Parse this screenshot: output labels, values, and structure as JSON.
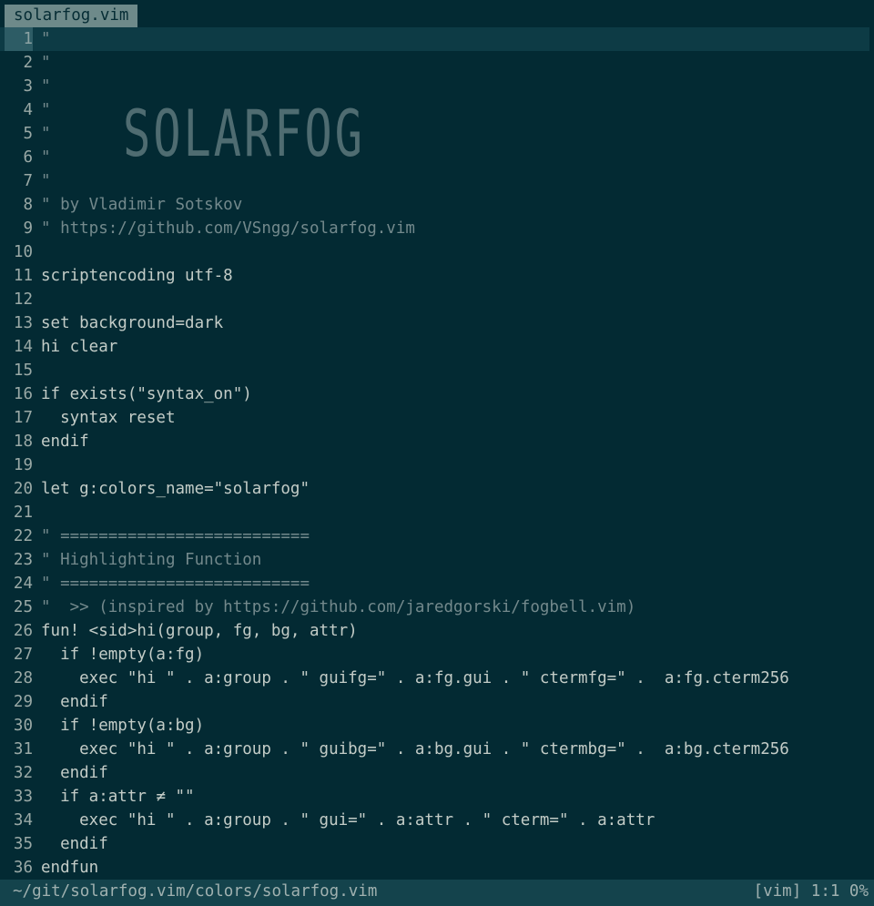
{
  "tabline": {
    "tab_label": "solarfog.vim"
  },
  "editor": {
    "logo_text": "SOLARFOG",
    "lines": [
      {
        "n": "1",
        "text": "\"",
        "comment": true
      },
      {
        "n": "2",
        "text": "\"",
        "comment": true
      },
      {
        "n": "3",
        "text": "\"",
        "comment": true
      },
      {
        "n": "4",
        "text": "\"",
        "comment": true
      },
      {
        "n": "5",
        "text": "\"",
        "comment": true
      },
      {
        "n": "6",
        "text": "\"",
        "comment": true
      },
      {
        "n": "7",
        "text": "\"",
        "comment": true
      },
      {
        "n": "8",
        "text": "\" by Vladimir Sotskov",
        "comment": true
      },
      {
        "n": "9",
        "text": "\" https://github.com/VSngg/solarfog.vim",
        "comment": true
      },
      {
        "n": "10",
        "text": "",
        "comment": false
      },
      {
        "n": "11",
        "text": "scriptencoding utf-8",
        "comment": false
      },
      {
        "n": "12",
        "text": "",
        "comment": false
      },
      {
        "n": "13",
        "text": "set background=dark",
        "comment": false
      },
      {
        "n": "14",
        "text": "hi clear",
        "comment": false
      },
      {
        "n": "15",
        "text": "",
        "comment": false
      },
      {
        "n": "16",
        "text": "if exists(\"syntax_on\")",
        "comment": false
      },
      {
        "n": "17",
        "text": "  syntax reset",
        "comment": false
      },
      {
        "n": "18",
        "text": "endif",
        "comment": false
      },
      {
        "n": "19",
        "text": "",
        "comment": false
      },
      {
        "n": "20",
        "text": "let g:colors_name=\"solarfog\"",
        "comment": false
      },
      {
        "n": "21",
        "text": "",
        "comment": false
      },
      {
        "n": "22",
        "text": "\" ==========================",
        "comment": true
      },
      {
        "n": "23",
        "text": "\" Highlighting Function",
        "comment": true
      },
      {
        "n": "24",
        "text": "\" ==========================",
        "comment": true
      },
      {
        "n": "25",
        "text": "\"  >> (inspired by https://github.com/jaredgorski/fogbell.vim)",
        "comment": true
      },
      {
        "n": "26",
        "text": "fun! <sid>hi(group, fg, bg, attr)",
        "comment": false
      },
      {
        "n": "27",
        "text": "  if !empty(a:fg)",
        "comment": false
      },
      {
        "n": "28",
        "text": "    exec \"hi \" . a:group . \" guifg=\" . a:fg.gui . \" ctermfg=\" .  a:fg.cterm256",
        "comment": false
      },
      {
        "n": "29",
        "text": "  endif",
        "comment": false
      },
      {
        "n": "30",
        "text": "  if !empty(a:bg)",
        "comment": false
      },
      {
        "n": "31",
        "text": "    exec \"hi \" . a:group . \" guibg=\" . a:bg.gui . \" ctermbg=\" .  a:bg.cterm256",
        "comment": false
      },
      {
        "n": "32",
        "text": "  endif",
        "comment": false
      },
      {
        "n": "33",
        "text": "  if a:attr ≠ \"\"",
        "comment": false
      },
      {
        "n": "34",
        "text": "    exec \"hi \" . a:group . \" gui=\" . a:attr . \" cterm=\" . a:attr",
        "comment": false
      },
      {
        "n": "35",
        "text": "  endif",
        "comment": false
      },
      {
        "n": "36",
        "text": "endfun",
        "comment": false
      }
    ]
  },
  "statusline": {
    "path": "~/git/solarfog.vim/colors/solarfog.vim",
    "right": "[vim] 1:1 0%"
  }
}
